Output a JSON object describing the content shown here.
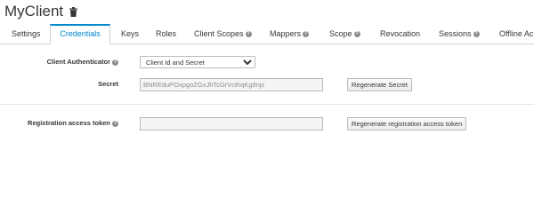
{
  "header": {
    "title": "MyClient",
    "trash_icon": "trash-icon"
  },
  "tabs": [
    {
      "label": "Settings",
      "help": false
    },
    {
      "label": "Credentials",
      "help": false,
      "active": true
    },
    {
      "label": "Keys",
      "help": false
    },
    {
      "label": "Roles",
      "help": false
    },
    {
      "label": "Client Scopes",
      "help": true
    },
    {
      "label": "Mappers",
      "help": true
    },
    {
      "label": "Scope",
      "help": true
    },
    {
      "label": "Revocation",
      "help": false
    },
    {
      "label": "Sessions",
      "help": true
    },
    {
      "label": "Offline Ac",
      "help": false
    }
  ],
  "form": {
    "authenticator_label": "Client Authenticator",
    "authenticator_value": "Client Id and Secret",
    "secret_label": "Secret",
    "secret_value": "BNREduPOxpgoZGxJhTcGrVcthqKg9njz",
    "regenerate_secret": "Regenerate Secret",
    "reg_token_label": "Registration access token",
    "reg_token_value": "",
    "regenerate_token": "Regenerate registration access token"
  },
  "colors": {
    "accent": "#0088ce",
    "help_icon": "#8b8d8f"
  }
}
